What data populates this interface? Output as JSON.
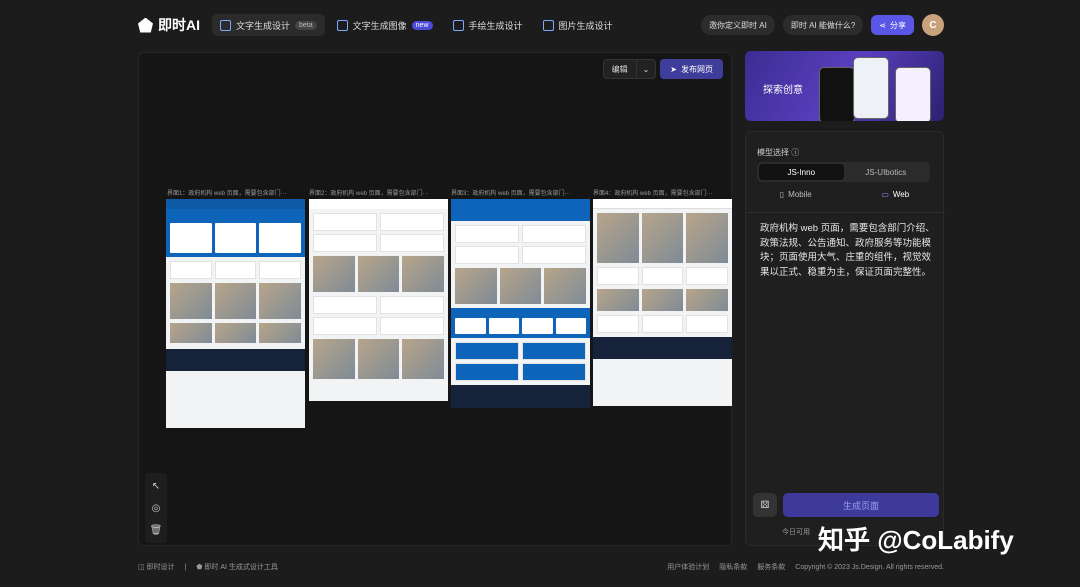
{
  "header": {
    "logo_text": "即时AI",
    "tabs": [
      {
        "label": "文字生成设计",
        "badge": "beta",
        "active": true
      },
      {
        "label": "文字生成图像",
        "badge": "new",
        "active": false
      },
      {
        "label": "手绘生成设计",
        "badge": "",
        "active": false
      },
      {
        "label": "图片生成设计",
        "badge": "",
        "active": false
      }
    ],
    "invite_label": "邀你定义即时 AI",
    "about_label": "即时 AI 能做什么?",
    "share_label": "分享",
    "avatar_initial": "C"
  },
  "canvas": {
    "edit_label": "编辑",
    "publish_label": "发布网页",
    "page_titles": [
      "界面1：政府机构 web 页面，需要包含部门···",
      "界面2：政府机构 web 页面，需要包含部门···",
      "界面3：政府机构 web 页面，需要包含部门···",
      "界面4：政府机构 web 页面，需要包含部门···"
    ],
    "tools": [
      "cursor-icon",
      "target-icon",
      "trash-icon"
    ]
  },
  "explore": {
    "label": "探索创意"
  },
  "panel": {
    "model_label": "模型选择",
    "models": [
      {
        "label": "JS-Inno",
        "active": true
      },
      {
        "label": "JS-UIbotics",
        "active": false
      }
    ],
    "platforms": [
      {
        "label": "Mobile",
        "active": false
      },
      {
        "label": "Web",
        "active": true
      }
    ],
    "prompt": "政府机构 web 页面，需要包含部门介绍、政策法规、公告通知、政府服务等功能模块；页面使用大气、庄重的组件，视觉效果以正式、稳重为主，保证页面完整性。",
    "generate_label": "生成页面",
    "quota_text": "今日可用"
  },
  "footer": {
    "brand_1": "即时设计",
    "brand_2": "即时 AI 生成式设计工具",
    "links": [
      "用户体验计划",
      "隐私条款",
      "服务条款"
    ],
    "copyright": "Copyright © 2023 Js.Design. All rights reserved."
  },
  "watermark": "知乎 @CoLabify"
}
